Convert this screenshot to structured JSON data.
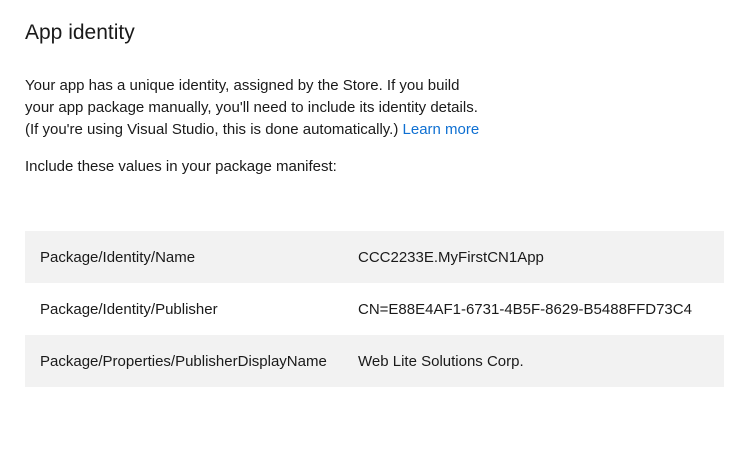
{
  "page": {
    "title": "App identity",
    "intro": {
      "line1": "Your app has a unique identity, assigned by the Store. If you build",
      "line2": "your app package manually, you'll need to include its identity details.",
      "line3": "(If you're using Visual Studio, this is done automatically.)",
      "learn_more_label": "Learn more"
    },
    "instruction": "Include these values in your package manifest:",
    "manifest_table": {
      "rows": [
        {
          "key": "Package/Identity/Name",
          "value": "CCC2233E.MyFirstCN1App"
        },
        {
          "key": "Package/Identity/Publisher",
          "value": "CN=E88E4AF1-6731-4B5F-8629-B5488FFD73C4"
        },
        {
          "key": "Package/Properties/PublisherDisplayName",
          "value": "Web Lite Solutions Corp."
        }
      ]
    }
  },
  "colors": {
    "text": "#1a1a1a",
    "link": "#0f70d2",
    "row_alt_bg": "#f2f2f2",
    "page_bg": "#ffffff"
  }
}
